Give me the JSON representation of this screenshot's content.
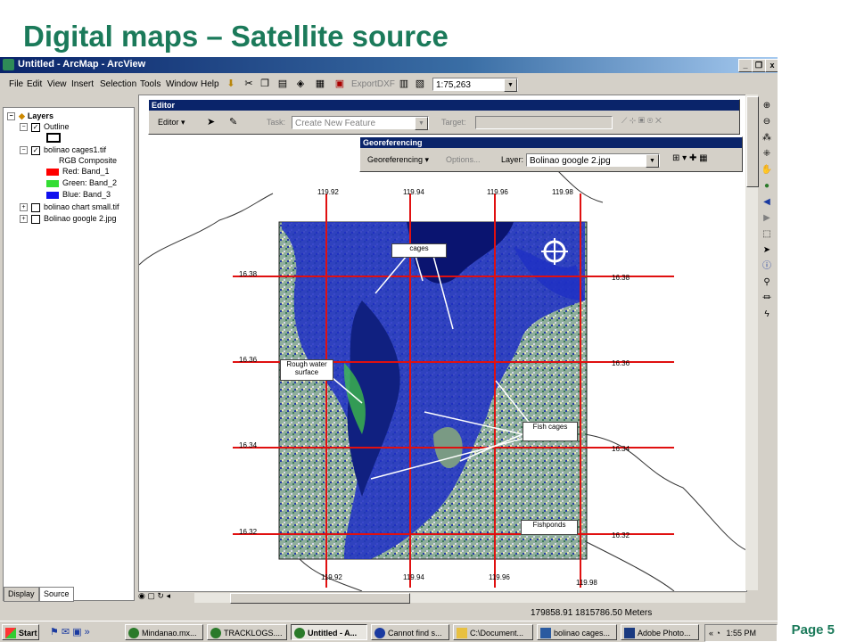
{
  "slide": {
    "title": "Digital maps – Satellite source",
    "page": "Page 5"
  },
  "window": {
    "title": "Untitled - ArcMap - ArcView",
    "controls": [
      "_",
      "❐",
      "x"
    ]
  },
  "menu": [
    "File",
    "Edit",
    "View",
    "Insert",
    "Selection",
    "Tools",
    "Window",
    "Help"
  ],
  "toolbar": {
    "export_label": "ExportDXF",
    "scale": "1:75,263"
  },
  "toc": {
    "root": "Layers",
    "layers": [
      {
        "name": "Outline",
        "checked": true
      },
      {
        "name": "bolinao cages1.tif",
        "checked": true
      },
      {
        "name": "bolinao chart small.tif",
        "checked": false
      },
      {
        "name": "Bolinao google 2.jpg",
        "checked": false
      }
    ],
    "composite": "RGB Composite",
    "bands": [
      {
        "label": "Red:   Band_1",
        "color": "#ff0000"
      },
      {
        "label": "Green: Band_2",
        "color": "#33dd33"
      },
      {
        "label": "Blue:  Band_3",
        "color": "#1010ee"
      }
    ],
    "tabs": [
      "Display",
      "Source"
    ]
  },
  "editor": {
    "title": "Editor",
    "menu_label": "Editor ▾",
    "task_label": "Task:",
    "task_value": "Create New Feature",
    "target_label": "Target:"
  },
  "georef": {
    "title": "Georeferencing",
    "menu_label": "Georeferencing ▾",
    "options_label": "Options...",
    "layer_label": "Layer:",
    "layer_value": "Bolinao google 2.jpg"
  },
  "map": {
    "lon_labels_top": [
      "119.92",
      "119.94",
      "119.96",
      "119.98"
    ],
    "lon_labels_bottom": [
      "119.92",
      "119.94",
      "119.96",
      "119.98"
    ],
    "lat_labels_left": [
      "16.38",
      "16.36",
      "16.34",
      "16.32"
    ],
    "lat_labels_right": [
      "16.38",
      "16.36",
      "16.34",
      "16.32"
    ],
    "callouts": {
      "cages": "cages",
      "rough": "Rough water surface",
      "fish": "Fish cages",
      "fishponds": "Fishponds"
    }
  },
  "status": {
    "coords": "179858.91  1815786.50 Meters"
  },
  "taskbar": {
    "start": "Start",
    "tasks": [
      "Mindanao.mx...",
      "TRACKLOGS....",
      "Untitled - A...",
      "Cannot find s...",
      "C:\\Document...",
      "bolinao cages...",
      "Adobe Photo..."
    ],
    "clock": "1:55 PM"
  }
}
